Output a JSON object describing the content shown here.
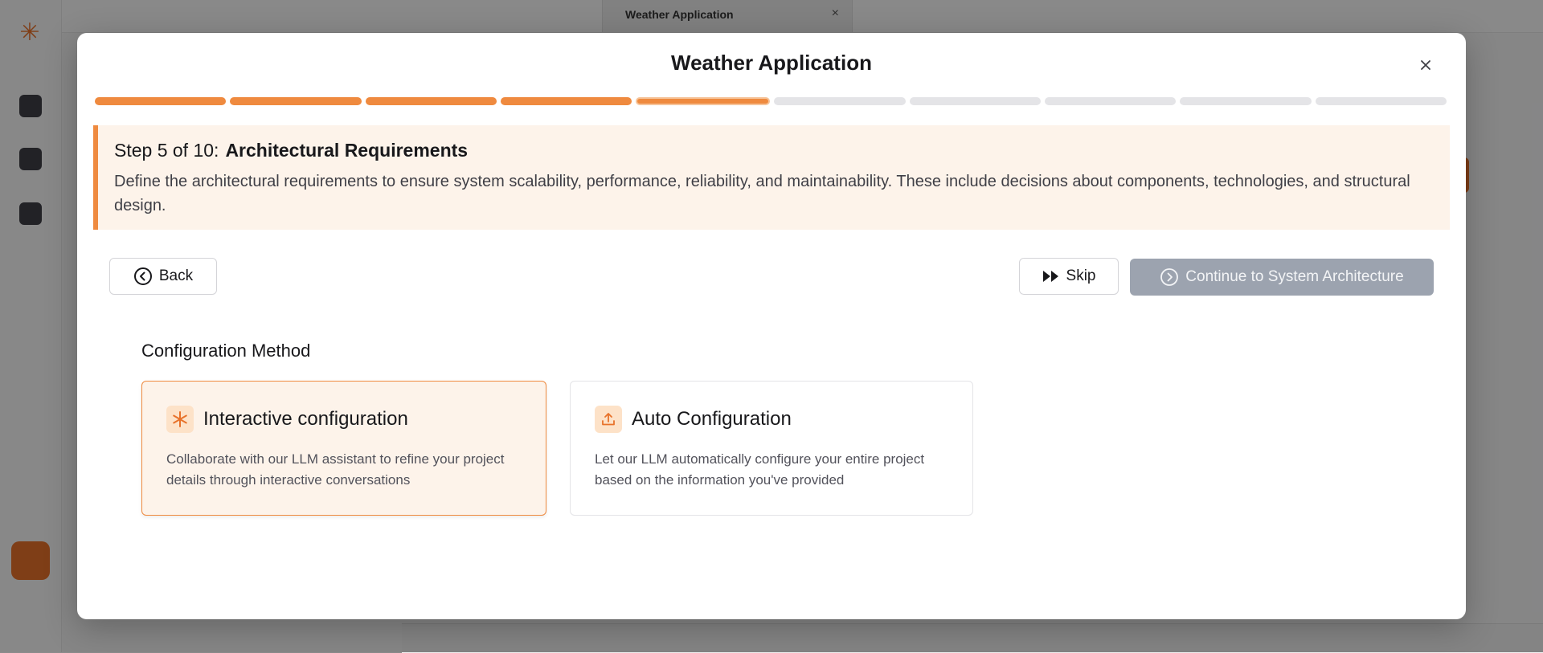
{
  "background": {
    "tab_title": "Weather Application",
    "tab_close": "×",
    "logo_glyph": "✳"
  },
  "modal": {
    "title": "Weather Application",
    "close_glyph": "×",
    "progress": {
      "total_steps": 10,
      "current_step": 5
    },
    "step": {
      "prefix": "Step 5 of 10:",
      "title": "Architectural Requirements",
      "description": "Define the architectural requirements to ensure system scalability, performance, reliability, and maintainability. These include decisions about components, technologies, and structural design."
    },
    "buttons": {
      "back": "Back",
      "skip": "Skip",
      "continue": "Continue to System Architecture"
    },
    "config": {
      "section_label": "Configuration Method",
      "interactive": {
        "title": "Interactive configuration",
        "description": "Collaborate with our LLM assistant to refine your project details through interactive conversations",
        "icon": "asterisk-icon"
      },
      "auto": {
        "title": "Auto Configuration",
        "description": "Let our LLM automatically configure your entire project based on the information you've provided",
        "icon": "upload-icon"
      }
    }
  },
  "colors": {
    "accent": "#ef8a3f",
    "accent_light": "#fdf3ea",
    "disabled_button": "#9ca3af"
  }
}
